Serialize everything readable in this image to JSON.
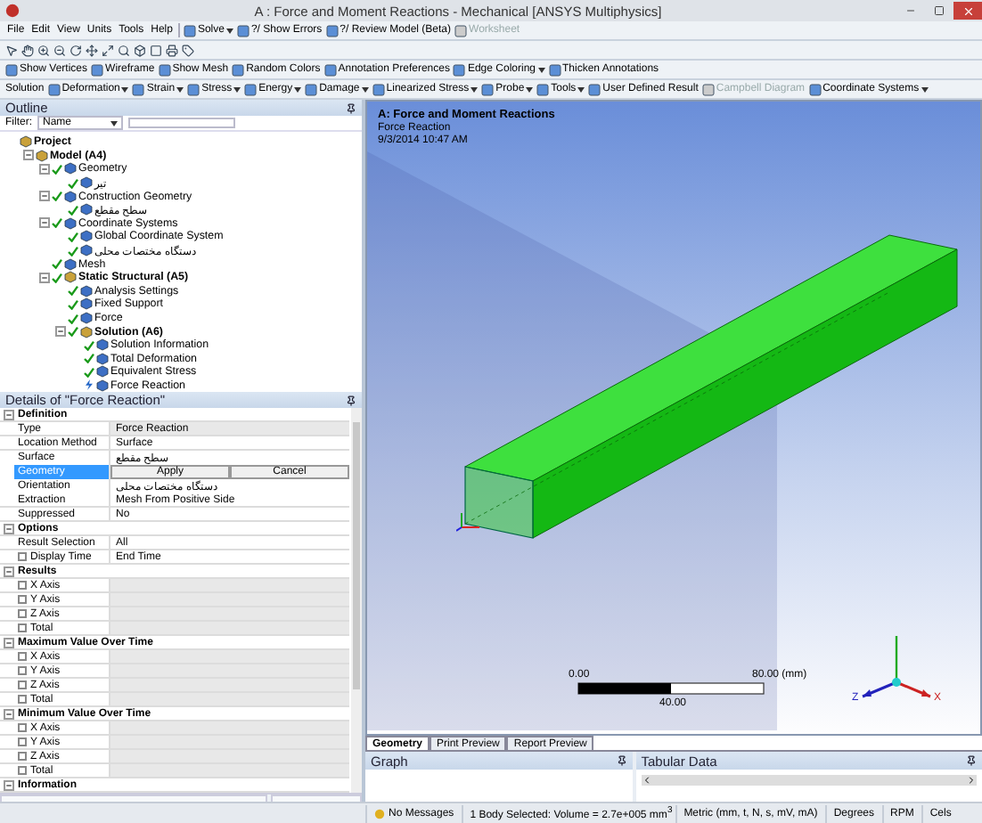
{
  "window": {
    "title": "A : Force and Moment Reactions - Mechanical [ANSYS Multiphysics]"
  },
  "menu": [
    "File",
    "Edit",
    "View",
    "Units",
    "Tools",
    "Help"
  ],
  "toolbar_1": [
    {
      "label": "Solve",
      "dropdown": true,
      "disabled": false
    },
    {
      "label": "?/ Show Errors",
      "dropdown": false,
      "disabled": false
    },
    {
      "label": "?/ Review Model (Beta)",
      "dropdown": false,
      "disabled": false
    },
    {
      "label": "Worksheet",
      "dropdown": false,
      "disabled": true
    }
  ],
  "toolbar_3": [
    {
      "label": "Show Vertices",
      "dropdown": false,
      "disabled": false
    },
    {
      "label": "Wireframe",
      "dropdown": false,
      "disabled": false
    },
    {
      "label": "Show Mesh",
      "dropdown": false,
      "disabled": false
    },
    {
      "label": "Random Colors",
      "dropdown": false,
      "disabled": false
    },
    {
      "label": "Annotation Preferences",
      "dropdown": false,
      "disabled": false
    },
    {
      "label": "Edge Coloring",
      "dropdown": true,
      "disabled": false
    },
    {
      "label": "Thicken Annotations",
      "dropdown": false,
      "disabled": false
    }
  ],
  "toolbar_4": [
    {
      "label": "Solution",
      "kind": "label",
      "dropdown": false,
      "disabled": false
    },
    {
      "label": "Deformation",
      "kind": "button",
      "dropdown": true,
      "disabled": false
    },
    {
      "label": "Strain",
      "kind": "button",
      "dropdown": true,
      "disabled": false
    },
    {
      "label": "Stress",
      "kind": "button",
      "dropdown": true,
      "disabled": false
    },
    {
      "label": "Energy",
      "kind": "button",
      "dropdown": true,
      "disabled": false
    },
    {
      "label": "Damage",
      "kind": "button",
      "dropdown": true,
      "disabled": false
    },
    {
      "label": "Linearized Stress",
      "kind": "button",
      "dropdown": true,
      "disabled": false
    },
    {
      "label": "Probe",
      "kind": "button",
      "dropdown": true,
      "disabled": false
    },
    {
      "label": "Tools",
      "kind": "button",
      "dropdown": true,
      "disabled": false
    },
    {
      "label": "User Defined Result",
      "kind": "button",
      "dropdown": false,
      "disabled": false
    },
    {
      "label": "Campbell Diagram",
      "kind": "button",
      "dropdown": false,
      "disabled": true
    },
    {
      "label": "Coordinate Systems",
      "kind": "button",
      "dropdown": true,
      "disabled": false
    }
  ],
  "outline": {
    "title": "Outline",
    "filter": {
      "label": "Filter:",
      "value": "Name"
    },
    "tree": [
      {
        "label": "Project",
        "kind": "heading",
        "children": [
          {
            "label": "Model (A4)",
            "kind": "heading",
            "expanded": true,
            "children": [
              {
                "label": "Geometry",
                "kind": "item",
                "solved": true,
                "expanded": true,
                "children": [
                  {
                    "label": "تیر",
                    "kind": "item",
                    "solved": true
                  }
                ]
              },
              {
                "label": "Construction Geometry",
                "kind": "item",
                "solved": true,
                "expanded": true,
                "children": [
                  {
                    "label": "سطح مقطع",
                    "kind": "item",
                    "solved": true
                  }
                ]
              },
              {
                "label": "Coordinate Systems",
                "kind": "item",
                "solved": true,
                "expanded": true,
                "children": [
                  {
                    "label": "Global Coordinate System",
                    "kind": "item",
                    "solved": true
                  },
                  {
                    "label": "دستگاه مختصات محلی",
                    "kind": "item",
                    "solved": true
                  }
                ]
              },
              {
                "label": "Mesh",
                "kind": "item",
                "solved": true
              },
              {
                "label": "Static Structural (A5)",
                "kind": "heading",
                "solved": true,
                "expanded": true,
                "children": [
                  {
                    "label": "Analysis Settings",
                    "kind": "item",
                    "solved": true
                  },
                  {
                    "label": "Fixed Support",
                    "kind": "item",
                    "solved": true
                  },
                  {
                    "label": "Force",
                    "kind": "item",
                    "solved": true
                  },
                  {
                    "label": "Solution (A6)",
                    "kind": "heading",
                    "solved": true,
                    "expanded": true,
                    "children": [
                      {
                        "label": "Solution Information",
                        "kind": "item",
                        "solved": true
                      },
                      {
                        "label": "Total Deformation",
                        "kind": "item",
                        "solved": true
                      },
                      {
                        "label": "Equivalent Stress",
                        "kind": "item",
                        "solved": true
                      },
                      {
                        "label": "Force Reaction",
                        "kind": "item",
                        "solved": false
                      }
                    ]
                  }
                ]
              }
            ]
          }
        ]
      }
    ]
  },
  "details": {
    "title": "Details of \"Force Reaction\"",
    "sections": [
      {
        "title": "Definition",
        "expanded": true,
        "rows": [
          {
            "label": "Type",
            "kind": "field",
            "value": "Force Reaction",
            "readonly": true,
            "selected": false
          },
          {
            "label": "Location Method",
            "kind": "field",
            "value": "Surface",
            "readonly": false,
            "selected": false
          },
          {
            "label": "Surface",
            "kind": "field",
            "value": "سطح مقطع",
            "readonly": false,
            "selected": false
          },
          {
            "label": "Geometry",
            "kind": "picker",
            "buttons": [
              "Apply",
              "Cancel"
            ],
            "selected": true
          },
          {
            "label": "Orientation",
            "kind": "field",
            "value": "دستگاه مختصات محلی",
            "readonly": false,
            "selected": false
          },
          {
            "label": "Extraction",
            "kind": "field",
            "value": "Mesh From Positive Side",
            "readonly": false,
            "selected": false
          },
          {
            "label": "Suppressed",
            "kind": "field",
            "value": "No",
            "readonly": false,
            "selected": false
          }
        ]
      },
      {
        "title": "Options",
        "expanded": true,
        "rows": [
          {
            "label": "Result Selection",
            "kind": "field",
            "value": "All",
            "readonly": false,
            "selected": false
          },
          {
            "label": "Display Time",
            "kind": "field",
            "value": "End Time",
            "readonly": false,
            "checked": false,
            "selected": false
          }
        ]
      },
      {
        "title": "Results",
        "expanded": true,
        "rows": [
          {
            "label": "X Axis",
            "kind": "field",
            "readonly": true,
            "checked": false,
            "selected": false
          },
          {
            "label": "Y Axis",
            "kind": "field",
            "readonly": true,
            "checked": false,
            "selected": false
          },
          {
            "label": "Z Axis",
            "kind": "field",
            "readonly": true,
            "checked": false,
            "selected": false
          },
          {
            "label": "Total",
            "kind": "field",
            "readonly": true,
            "checked": false,
            "selected": false
          }
        ]
      },
      {
        "title": "Maximum Value Over Time",
        "expanded": true,
        "rows": [
          {
            "label": "X Axis",
            "kind": "field",
            "readonly": true,
            "checked": false,
            "selected": false
          },
          {
            "label": "Y Axis",
            "kind": "field",
            "readonly": true,
            "checked": false,
            "selected": false
          },
          {
            "label": "Z Axis",
            "kind": "field",
            "readonly": true,
            "checked": false,
            "selected": false
          },
          {
            "label": "Total",
            "kind": "field",
            "readonly": true,
            "checked": false,
            "selected": false
          }
        ]
      },
      {
        "title": "Minimum Value Over Time",
        "expanded": true,
        "rows": [
          {
            "label": "X Axis",
            "kind": "field",
            "readonly": true,
            "checked": false,
            "selected": false
          },
          {
            "label": "Y Axis",
            "kind": "field",
            "readonly": true,
            "checked": false,
            "selected": false
          },
          {
            "label": "Z Axis",
            "kind": "field",
            "readonly": true,
            "checked": false,
            "selected": false
          },
          {
            "label": "Total",
            "kind": "field",
            "readonly": true,
            "checked": false,
            "selected": false
          }
        ]
      },
      {
        "title": "Information",
        "expanded": true
      }
    ]
  },
  "graphics": {
    "heading": "A: Force and Moment Reactions",
    "subtitle": "Force Reaction",
    "date": "9/3/2014 10:47 AM",
    "scale": {
      "min": "0.00",
      "max": "80.00 (mm)",
      "mid": "40.00"
    },
    "triad": [
      "Z",
      "X"
    ]
  },
  "tabs": [
    {
      "label": "Geometry",
      "selected": true
    },
    {
      "label": "Print Preview",
      "selected": false
    },
    {
      "label": "Report Preview",
      "selected": false
    }
  ],
  "graph": {
    "title": "Graph"
  },
  "tabular": {
    "title": "Tabular Data"
  },
  "status_bar": {
    "message": "No Messages",
    "selection": "1 Body Selected: Volume = 2.7e+005 mm$^{3}$",
    "units": "Metric (mm, t, N, s, mV, mA)",
    "angle": "Degrees",
    "speed": "RPM",
    "temperature": "Cels"
  }
}
